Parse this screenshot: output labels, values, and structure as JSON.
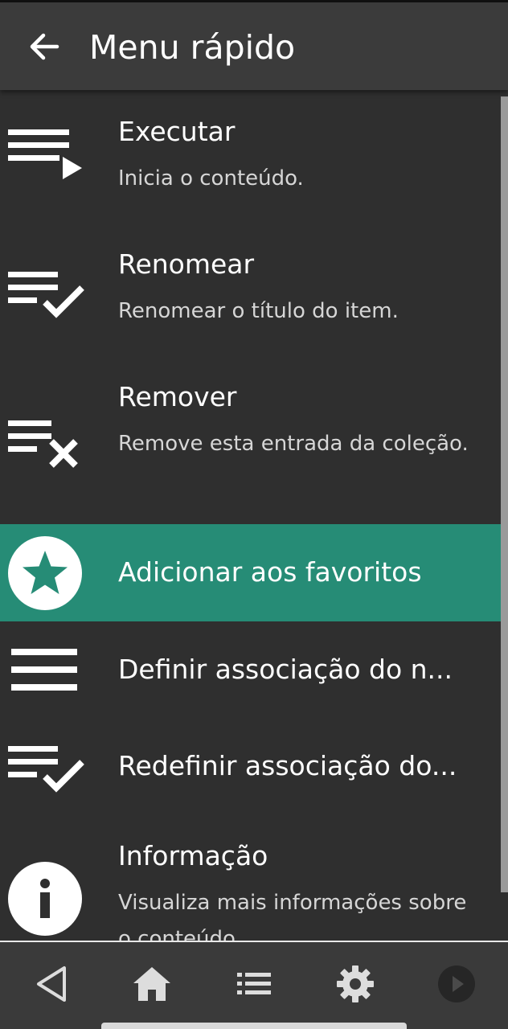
{
  "header": {
    "title": "Menu rápido",
    "back_icon": "arrow-back-icon"
  },
  "menu": {
    "items": [
      {
        "label": "Executar",
        "description": "Inicia o conteúdo.",
        "icon": "playlist-play-icon",
        "selected": false
      },
      {
        "label": "Renomear",
        "description": "Renomear o título do item.",
        "icon": "playlist-check-icon",
        "selected": false
      },
      {
        "label": "Remover",
        "description": "Remove esta entrada da coleção.",
        "icon": "playlist-remove-icon",
        "selected": false
      },
      {
        "label": "Adicionar aos favoritos",
        "description": "",
        "icon": "star-circle-icon",
        "selected": true
      },
      {
        "label": "Definir associação do n...",
        "description": "",
        "icon": "menu-lines-icon",
        "selected": false
      },
      {
        "label": "Redefinir associação do...",
        "description": "",
        "icon": "playlist-check-icon",
        "selected": false
      },
      {
        "label": "Informação",
        "description": "Visualiza mais informações sobre o conteúdo.",
        "icon": "info-circle-icon",
        "selected": false
      }
    ]
  },
  "navbar": {
    "items": [
      "back-triangle-icon",
      "home-icon",
      "list-icon",
      "gear-icon",
      "play-circle-icon"
    ]
  },
  "colors": {
    "background": "#2f2f2f",
    "header": "#3b3b3b",
    "selected": "#268c76",
    "navbar": "#3a3a3a"
  }
}
